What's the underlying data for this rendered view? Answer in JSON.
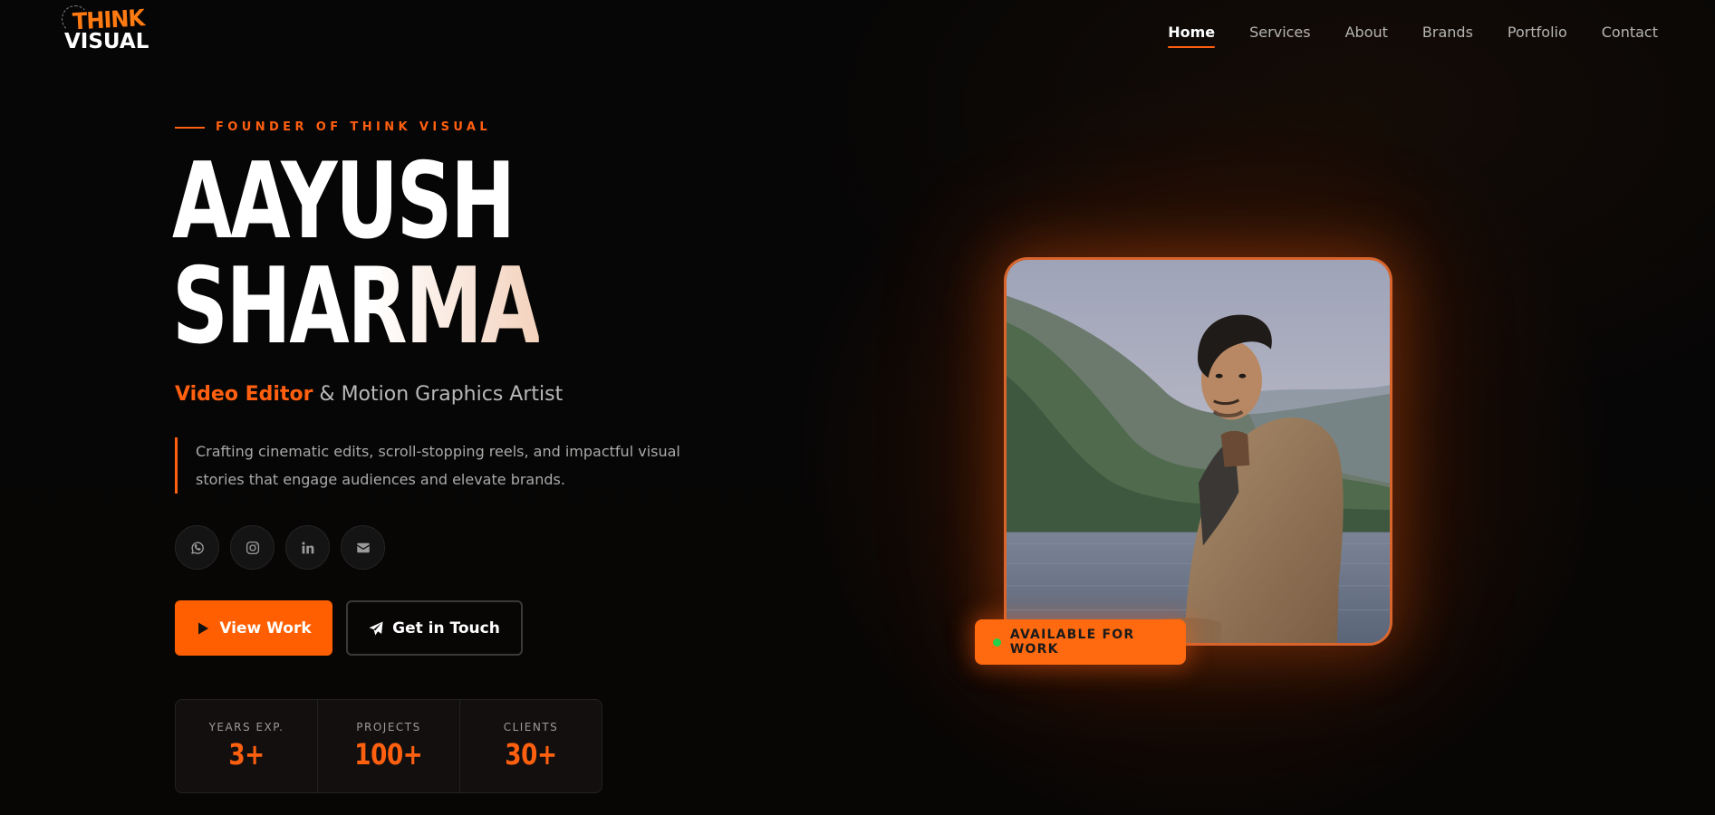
{
  "logo": {
    "line1": "THINK",
    "line2": "VISUAL"
  },
  "nav": {
    "items": [
      {
        "label": "Home",
        "active": true
      },
      {
        "label": "Services"
      },
      {
        "label": "About"
      },
      {
        "label": "Brands"
      },
      {
        "label": "Portfolio"
      },
      {
        "label": "Contact"
      }
    ]
  },
  "hero": {
    "eyebrow": "FOUNDER OF THINK VISUAL",
    "name_line1": "AAYUSH",
    "name_line2": "SHARMA",
    "role_accent": "Video Editor",
    "role_rest": " & Motion Graphics Artist",
    "description": "Crafting cinematic edits, scroll-stopping reels, and impactful visual stories that engage audiences and elevate brands.",
    "socials": [
      "whatsapp-icon",
      "instagram-icon",
      "linkedin-icon",
      "mail-icon"
    ],
    "primary_button": "View Work",
    "secondary_button": "Get in Touch",
    "stats": [
      {
        "label": "YEARS EXP.",
        "value": "3+"
      },
      {
        "label": "PROJECTS",
        "value": "100+"
      },
      {
        "label": "CLIENTS",
        "value": "30+"
      }
    ],
    "availability_badge": "AVAILABLE FOR WORK"
  },
  "colors": {
    "accent": "#ff5f00",
    "background": "#050505",
    "status_dot": "#27d04a"
  }
}
